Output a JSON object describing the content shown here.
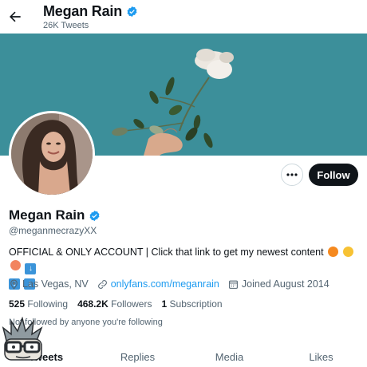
{
  "header": {
    "name": "Megan Rain",
    "tweet_count": "26K Tweets"
  },
  "profile": {
    "display_name": "Megan Rain",
    "handle": "@meganmecrazyXX",
    "bio_text": "OFFICIAL & ONLY ACCOUNT | Click that link to get my newest content",
    "location": "Las Vegas, NV",
    "link": "onlyfans.com/meganrain",
    "joined": "Joined August 2014",
    "following_count": "525",
    "following_label": "Following",
    "followers_count": "468.2K",
    "followers_label": "Followers",
    "subscription_count": "1",
    "subscription_label": "Subscription",
    "followed_by": "Not followed by anyone you're following"
  },
  "actions": {
    "follow_label": "Follow",
    "more_icon": "more-icon"
  },
  "tabs": [
    {
      "label": "Tweets"
    },
    {
      "label": "Replies"
    },
    {
      "label": "Media"
    },
    {
      "label": "Likes"
    }
  ],
  "colors": {
    "accent": "#1d9bf0",
    "banner": "#3c8f9a",
    "text": "#0f1419",
    "muted": "#536471"
  }
}
